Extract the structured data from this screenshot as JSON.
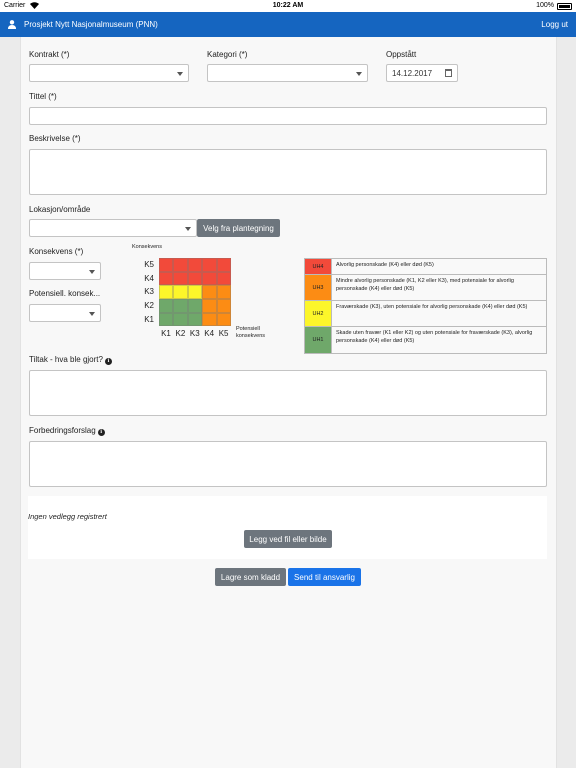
{
  "status_bar": {
    "carrier": "Carrier",
    "time": "10:22 AM",
    "battery": "100%"
  },
  "navbar": {
    "title": "Prosjekt Nytt Nasjonalmuseum (PNN)",
    "logout": "Logg ut"
  },
  "form": {
    "kontrakt": {
      "label": "Kontrakt (*)",
      "value": ""
    },
    "kategori": {
      "label": "Kategori (*)",
      "value": ""
    },
    "oppstatt": {
      "label": "Oppstått",
      "value": "14.12.2017"
    },
    "tittel": {
      "label": "Tittel (*)",
      "value": ""
    },
    "beskrivelse": {
      "label": "Beskrivelse (*)",
      "value": ""
    },
    "lokasjon": {
      "label": "Lokasjon/område",
      "value": "",
      "button": "Velg fra plantegning"
    },
    "konsekvens": {
      "label": "Konsekvens (*)",
      "value": ""
    },
    "potensiell": {
      "label": "Potensiell. konsek...",
      "value": ""
    },
    "tiltak": {
      "label": "Tiltak - hva ble gjort?",
      "value": ""
    },
    "forbedring": {
      "label": "Forbedringsforslag",
      "value": ""
    }
  },
  "matrix": {
    "y_title": "Konsekvens",
    "x_title_line1": "Potensiell",
    "x_title_line2": "konsekvens",
    "rows": [
      "K5",
      "K4",
      "K3",
      "K2",
      "K1"
    ],
    "cols": [
      "K1",
      "K2",
      "K3",
      "K4",
      "K5"
    ],
    "colors": {
      "red": "#f24a3a",
      "orange": "#fc8c14",
      "yellow": "#fcf62a",
      "green": "#6fa86a"
    },
    "grid": [
      [
        "red",
        "red",
        "red",
        "red",
        "red"
      ],
      [
        "red",
        "red",
        "red",
        "red",
        "red"
      ],
      [
        "yellow",
        "yellow",
        "yellow",
        "orange",
        "orange"
      ],
      [
        "green",
        "green",
        "green",
        "orange",
        "orange"
      ],
      [
        "green",
        "green",
        "green",
        "orange",
        "orange"
      ]
    ]
  },
  "legend": [
    {
      "code": "UH4",
      "color": "#f24a3a",
      "text": "Alvorlig personskade (K4) eller død (K5)"
    },
    {
      "code": "UH3",
      "color": "#fc8c14",
      "text": "Mindre alvorlig personskade (K1, K2 eller K3), med potensiale for alvorlig personskade (K4) eller død (K5)"
    },
    {
      "code": "UH2",
      "color": "#fcf62a",
      "text": "Fraværskade (K3), uten potensiale for alvorlig personskade (K4) eller død (K5)"
    },
    {
      "code": "UH1",
      "color": "#6fa86a",
      "text": "Skade uten fravær (K1 eller K2) og uten potensiale for fraværskade (K3), alvorlig personskade (K4) eller død (K5)"
    }
  ],
  "attachments": {
    "empty_text": "Ingen vedlegg registrert",
    "add_button": "Legg ved fil eller bilde"
  },
  "actions": {
    "save_draft": "Lagre som kladd",
    "send": "Send til ansvarlig"
  },
  "colors": {
    "nav": "#1565c0",
    "primary_button": "#1a73e8",
    "secondary_button": "#6d757d"
  }
}
